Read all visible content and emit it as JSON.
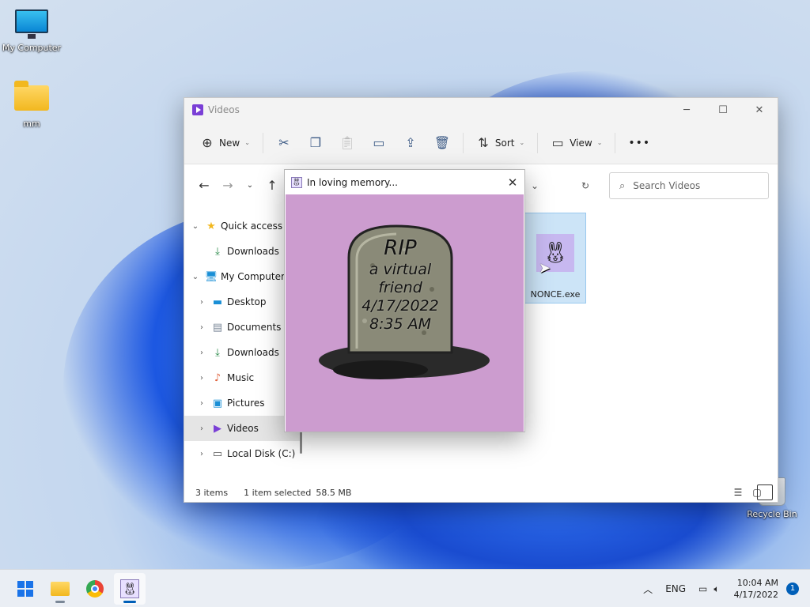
{
  "desktop": {
    "icons": [
      {
        "label": "My Computer",
        "icon": "monitor-icon"
      },
      {
        "label": "mm",
        "icon": "folder-icon"
      },
      {
        "label": "Recycle Bin",
        "icon": "recycle-bin-icon"
      }
    ]
  },
  "explorer": {
    "title": "Videos",
    "toolbar": {
      "new_label": "New",
      "sort_label": "Sort",
      "view_label": "View",
      "more_label": "•••"
    },
    "search_placeholder": "Search Videos",
    "sidebar": [
      {
        "label": "Quick access",
        "icon": "star-icon",
        "level": 0,
        "expand": "⌄"
      },
      {
        "label": "Downloads",
        "icon": "download-icon",
        "level": 1,
        "expand": ""
      },
      {
        "label": "My Computer",
        "icon": "monitor-icon",
        "level": 0,
        "expand": "⌄"
      },
      {
        "label": "Desktop",
        "icon": "desktop-icon",
        "level": 1,
        "expand": "›"
      },
      {
        "label": "Documents",
        "icon": "document-icon",
        "level": 1,
        "expand": "›"
      },
      {
        "label": "Downloads",
        "icon": "download-icon",
        "level": 1,
        "expand": "›"
      },
      {
        "label": "Music",
        "icon": "music-icon",
        "level": 1,
        "expand": "›"
      },
      {
        "label": "Pictures",
        "icon": "picture-icon",
        "level": 1,
        "expand": "›"
      },
      {
        "label": "Videos",
        "icon": "video-icon",
        "level": 1,
        "expand": "›",
        "selected": true
      },
      {
        "label": "Local Disk (C:)",
        "icon": "disk-icon",
        "level": 1,
        "expand": "›"
      }
    ],
    "file": {
      "name": "NONCE.exe",
      "icon": "bunny-icon"
    },
    "status": {
      "items": "3 items",
      "selected": "1 item selected",
      "size": "58.5 MB"
    }
  },
  "popup": {
    "title": "In loving memory...",
    "close": "✕",
    "tombstone": {
      "line1": "RIP",
      "line2": "a virtual",
      "line3": "friend",
      "line4": "4/17/2022",
      "line5": "8:35 AM"
    },
    "colors": {
      "background": "#cc9ccf",
      "stone": "#8a8a78"
    }
  },
  "taskbar": {
    "apps": [
      {
        "name": "start-button",
        "icon": "windows-icon"
      },
      {
        "name": "file-explorer",
        "icon": "folder-icon"
      },
      {
        "name": "chrome",
        "icon": "chrome-icon"
      },
      {
        "name": "nonce-app",
        "icon": "bunny-icon",
        "active": true
      }
    ],
    "language": "ENG",
    "time": "10:04 AM",
    "date": "4/17/2022",
    "notifications": "1"
  }
}
